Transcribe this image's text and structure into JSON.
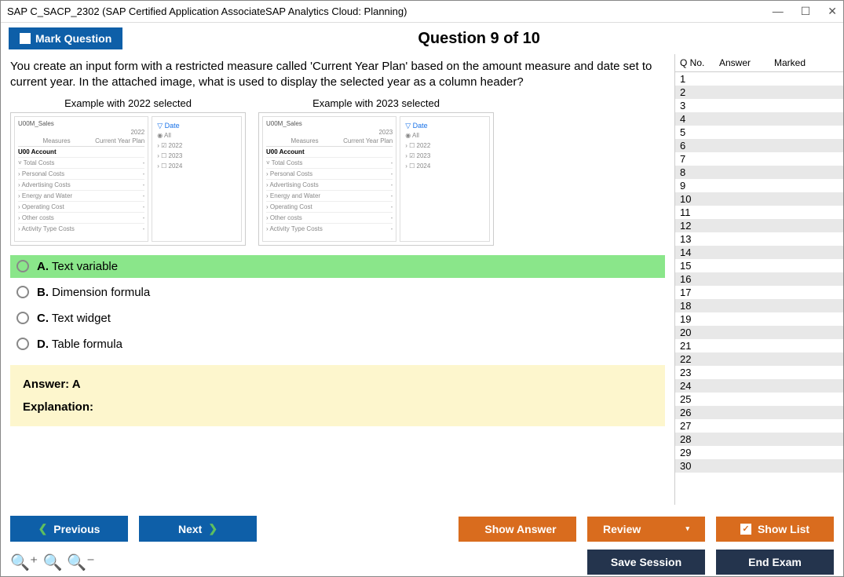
{
  "window": {
    "title": "SAP C_SACP_2302 (SAP Certified Application AssociateSAP Analytics Cloud: Planning)"
  },
  "header": {
    "mark_label": "Mark Question",
    "question_title": "Question 9 of 10"
  },
  "question": {
    "text": "You create an input form with a restricted measure called 'Current Year Plan' based on the amount measure and date set to current year. In the attached image, what is used to display the selected year as a column header?"
  },
  "images": [
    {
      "caption": "Example with 2022 selected",
      "model": "U00M_Sales",
      "year": "2022",
      "col_measures": "Measures",
      "col_plan": "Current Year Plan",
      "account": "U00 Account",
      "rows": [
        "Total Costs",
        "Personal Costs",
        "Advertising Costs",
        "Energy and Water",
        "Operating Cost",
        "Other costs",
        "Activity Type Costs"
      ],
      "filter_title": "Date",
      "filter_all": "All",
      "opts": [
        "2022",
        "2023",
        "2024"
      ],
      "checked_idx": 0
    },
    {
      "caption": "Example with 2023 selected",
      "model": "U00M_Sales",
      "year": "2023",
      "col_measures": "Measures",
      "col_plan": "Current Year Plan",
      "account": "U00 Account",
      "rows": [
        "Total Costs",
        "Personal Costs",
        "Advertising Costs",
        "Energy and Water",
        "Operating Cost",
        "Other costs",
        "Activity Type Costs"
      ],
      "filter_title": "Date",
      "filter_all": "All",
      "opts": [
        "2022",
        "2023",
        "2024"
      ],
      "checked_idx": 1
    }
  ],
  "options": [
    {
      "letter": "A.",
      "text": "Text variable",
      "correct": true
    },
    {
      "letter": "B.",
      "text": "Dimension formula",
      "correct": false
    },
    {
      "letter": "C.",
      "text": "Text widget",
      "correct": false
    },
    {
      "letter": "D.",
      "text": "Table formula",
      "correct": false
    }
  ],
  "answer": {
    "label": "Answer: A",
    "explanation_label": "Explanation:"
  },
  "sidebar": {
    "h1": "Q No.",
    "h2": "Answer",
    "h3": "Marked",
    "count": 30
  },
  "footer": {
    "previous": "Previous",
    "next": "Next",
    "show_answer": "Show Answer",
    "review": "Review",
    "show_list": "Show List",
    "save_session": "Save Session",
    "end_exam": "End Exam"
  }
}
